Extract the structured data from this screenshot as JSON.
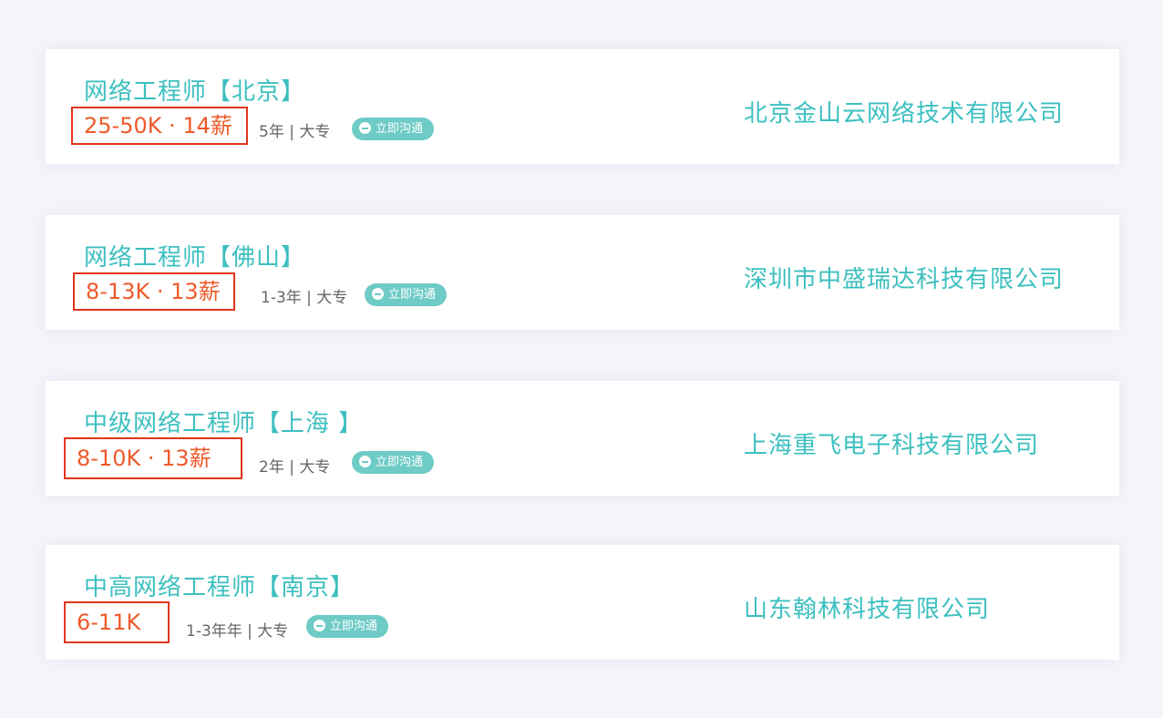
{
  "jobs": [
    {
      "title": "网络工程师【北京】",
      "salary": "25-50K · 14薪",
      "meta": "5年 |  大专",
      "chat": "立即沟通",
      "company": "北京金山云网络技术有限公司"
    },
    {
      "title": "网络工程师【佛山】",
      "salary": "8-13K · 13薪",
      "meta": "1-3年 |  大专",
      "chat": "立即沟通",
      "company": "深圳市中盛瑞达科技有限公司"
    },
    {
      "title": "中级网络工程师【上海 】",
      "salary": "8-10K · 13薪",
      "meta": "2年 |  大专",
      "chat": "立即沟通",
      "company": "上海重飞电子科技有限公司"
    },
    {
      "title": "中高网络工程师【南京】",
      "salary": "6-11K",
      "meta": "1-3年年 |  大专",
      "chat": "立即沟通",
      "company": "山东翰林科技有限公司"
    }
  ],
  "colors": {
    "accent": "#3dbfbf",
    "salary": "#ef5a2a",
    "highlight_border": "#e0361e",
    "chat_button": "#6ecbc6"
  }
}
